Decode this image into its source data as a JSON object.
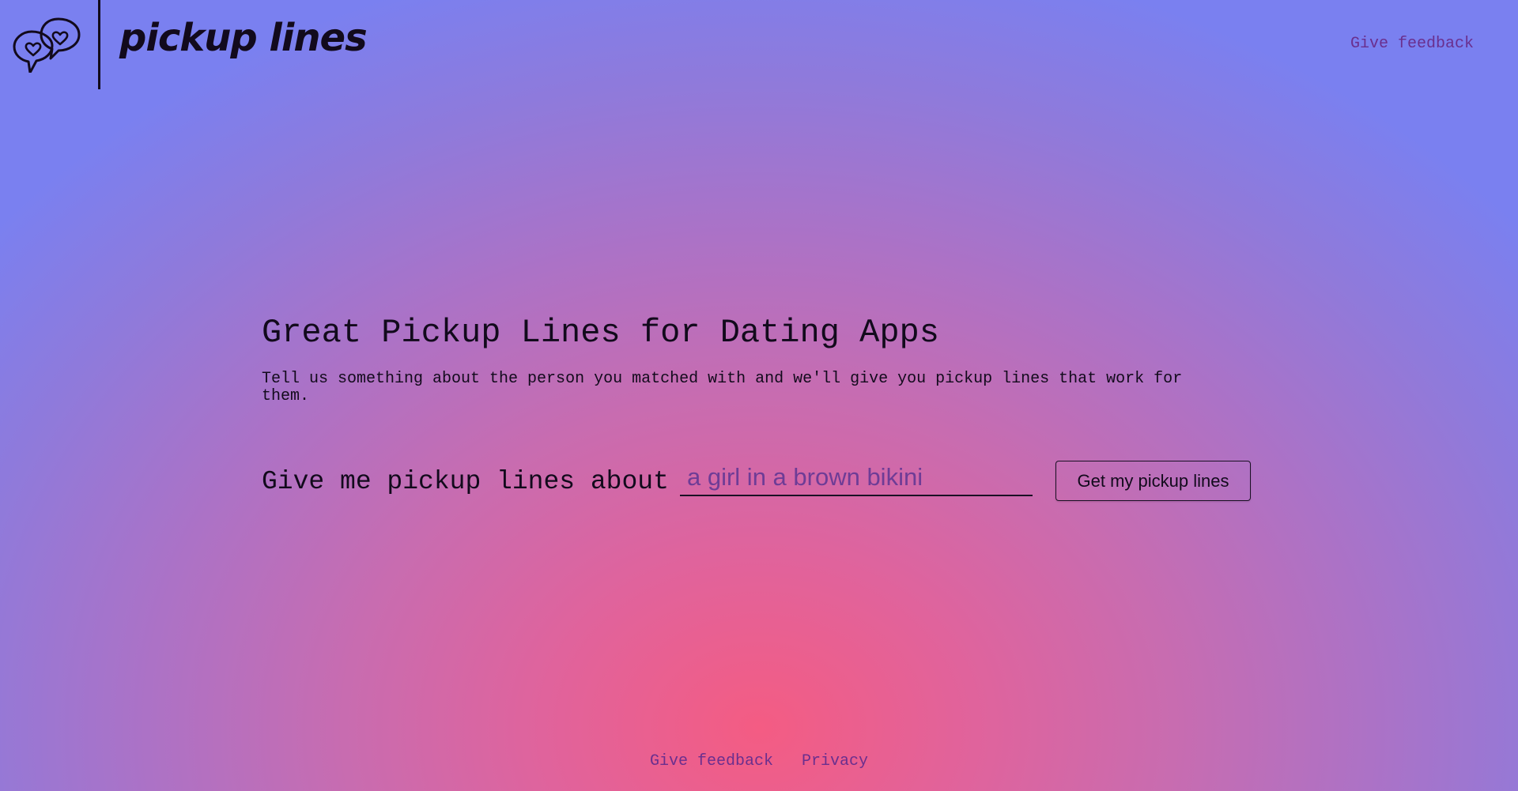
{
  "header": {
    "logo_text": "pickup lines",
    "logo_icon": "heart-speech-bubbles-icon",
    "feedback_label": "Give feedback"
  },
  "main": {
    "title": "Great Pickup Lines for Dating Apps",
    "description": "Tell us something about the person you matched with and we'll give you pickup lines that work for them.",
    "prompt_label": "Give me pickup lines about",
    "input_value": "",
    "input_placeholder": "a girl in a brown bikini",
    "submit_label": "Get my pickup lines"
  },
  "footer": {
    "links": [
      {
        "label": "Give feedback"
      },
      {
        "label": "Privacy"
      }
    ]
  },
  "colors": {
    "background_center": "#f45c83",
    "background_edge": "#7a80f0",
    "text": "#120a1c",
    "link": "#6a2f8e"
  }
}
